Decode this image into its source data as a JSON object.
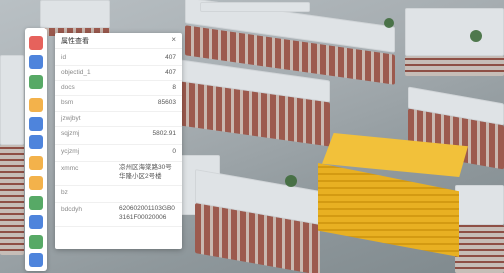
{
  "panel": {
    "title": "属性查看",
    "close_label": "×",
    "rows": [
      {
        "key": "id",
        "value": "407"
      },
      {
        "key": "objectid_1",
        "value": "407"
      },
      {
        "key": "docs",
        "value": "8"
      },
      {
        "key": "bsm",
        "value": "85603"
      },
      {
        "key": "jzwjbyt",
        "value": ""
      },
      {
        "key": "sqjzmj",
        "value": "5802.91"
      },
      {
        "key": "ycjzmj",
        "value": "0"
      },
      {
        "key": "xmmc",
        "value": "凉州区海棠路30号华隆小区2号楼"
      },
      {
        "key": "bz",
        "value": ""
      },
      {
        "key": "bdcdyh",
        "value": "620602001103GB03161F00020006"
      }
    ]
  },
  "toolbar": {
    "icons": [
      {
        "name": "layers-icon",
        "color": "#e2473f"
      },
      {
        "name": "tag-icon",
        "color": "#2f6fd6"
      },
      {
        "name": "grid-icon",
        "color": "#3a9a4b"
      },
      {
        "name": "location-icon",
        "color": "#f1a52b"
      },
      {
        "name": "document-icon",
        "color": "#2f6fd6"
      },
      {
        "name": "edit-icon",
        "color": "#2f6fd6"
      },
      {
        "name": "compass-icon",
        "color": "#f1a52b"
      },
      {
        "name": "folder-icon",
        "color": "#f1a52b"
      },
      {
        "name": "person-icon",
        "color": "#3a9a4b"
      },
      {
        "name": "chat-icon",
        "color": "#2f6fd6"
      },
      {
        "name": "database-icon",
        "color": "#3a9a4b"
      },
      {
        "name": "settings-icon",
        "color": "#2f6fd6"
      }
    ]
  },
  "colors": {
    "highlight_building": "#f2c13a",
    "panel_bg": "#ffffff"
  }
}
